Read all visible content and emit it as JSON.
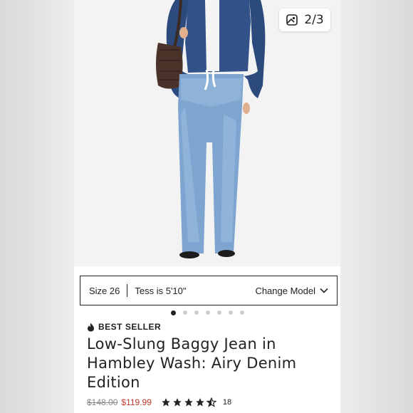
{
  "counter": {
    "label": "2/3"
  },
  "size_bar": {
    "size": "Size 26",
    "model": "Tess is 5'10\"",
    "change_label": "Change Model"
  },
  "carousel": {
    "total": 7,
    "active_index": 0
  },
  "badge": {
    "label": "BEST SELLER"
  },
  "product": {
    "title": "Low-Slung Baggy Jean in Hambley Wash: Airy Denim Edition",
    "price_original": "$148.00",
    "price_sale": "$119.99",
    "rating": 4.5,
    "review_count": "18"
  },
  "colors": {
    "sale": "#c0392b",
    "text": "#222222"
  }
}
